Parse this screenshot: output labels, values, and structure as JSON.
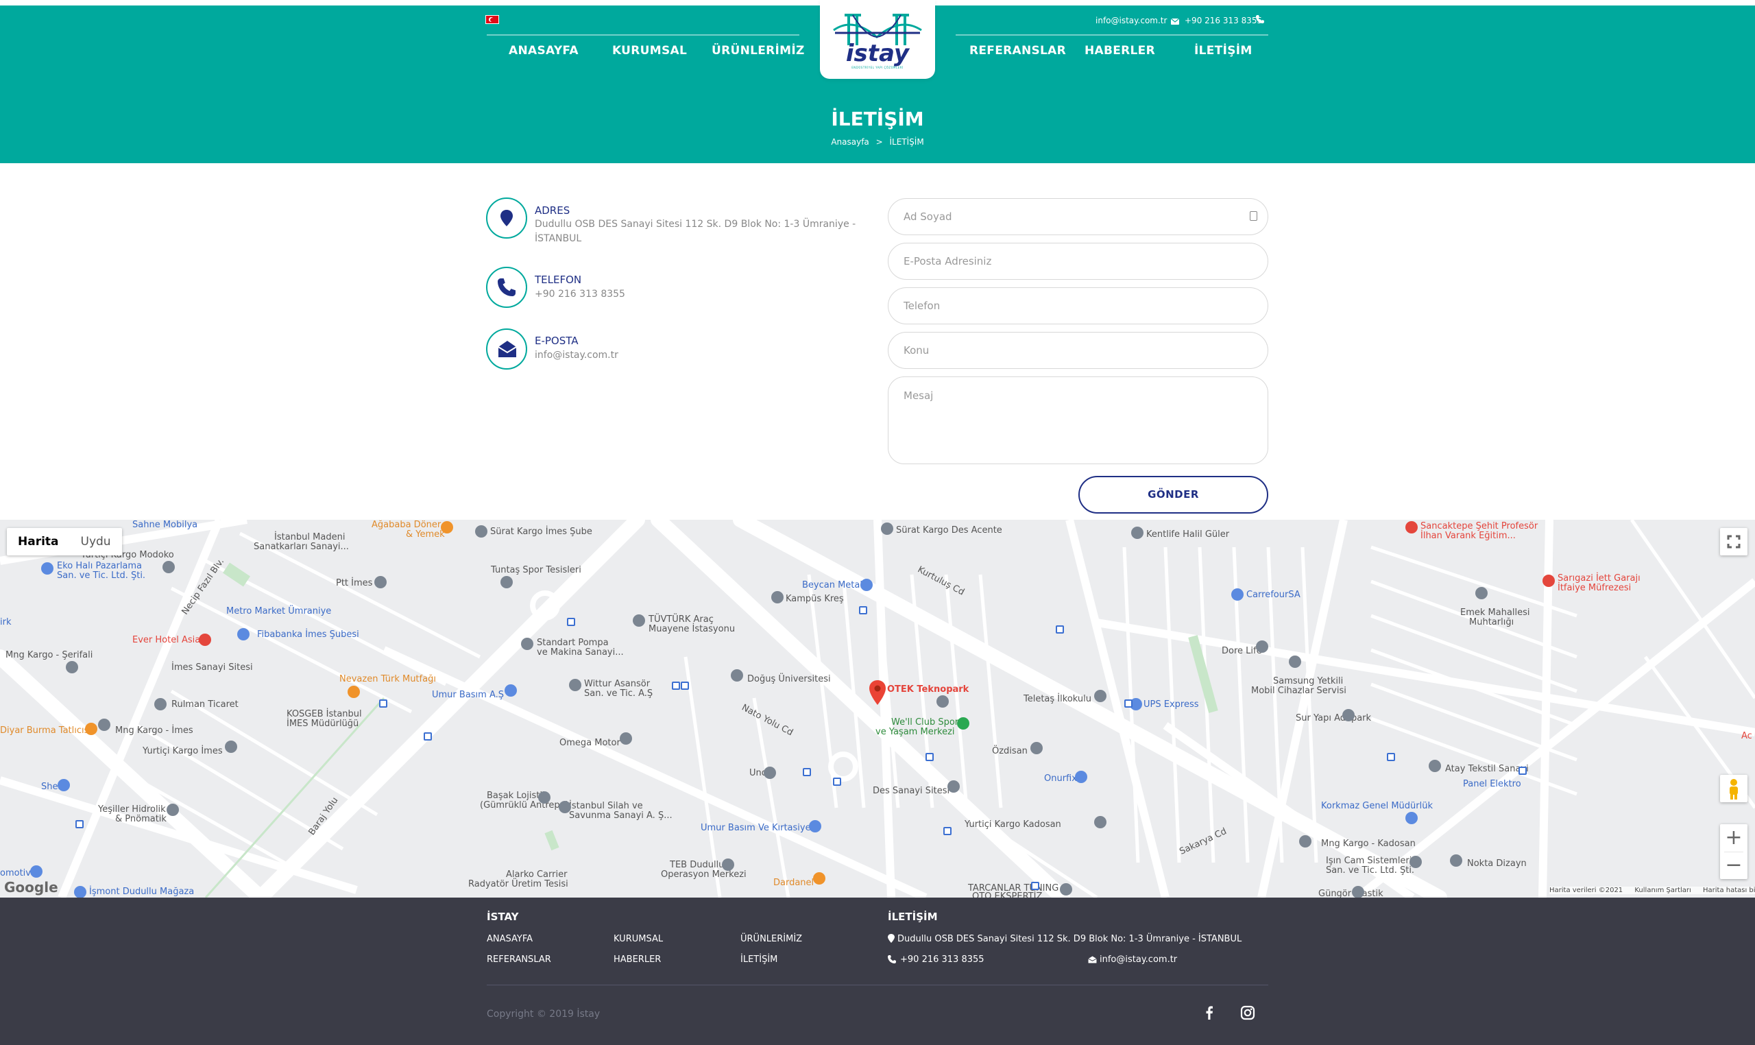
{
  "header": {
    "email": "info@istay.com.tr",
    "phone": "+90 216 313 8355",
    "nav_left": [
      "ANASAYFA",
      "KURUMSAL",
      "ÜRÜNLERİMİZ"
    ],
    "nav_right": [
      "REFERANSLAR",
      "HABERLER",
      "İLETİŞİM"
    ],
    "logo_text": "istay",
    "logo_tagline": "ENDÜSTRİYEL YAPI ÇÖZÜMLERİ"
  },
  "page": {
    "title": "İLETİŞİM",
    "breadcrumb_home": "Anasayfa",
    "breadcrumb_sep": ">",
    "breadcrumb_current": "İLETİŞİM"
  },
  "contact": {
    "address_label": "ADRES",
    "address_line1": "Dudullu OSB DES Sanayi Sitesi 112 Sk. D9 Blok No: 1-3 Ümraniye -",
    "address_line2": "İSTANBUL",
    "phone_label": "TELEFON",
    "phone_value": "+90 216 313 8355",
    "email_label": "E-POSTA",
    "email_value": "info@istay.com.tr"
  },
  "form": {
    "name_placeholder": "Ad Soyad",
    "email_placeholder": "E-Posta Adresiniz",
    "phone_placeholder": "Telefon",
    "subject_placeholder": "Konu",
    "message_placeholder": "Mesaj",
    "submit_label": "GÖNDER"
  },
  "map": {
    "type_map": "Harita",
    "type_satellite": "Uydu",
    "zoom_in": "+",
    "zoom_out": "−",
    "google": "Google",
    "attribution": [
      "Harita verileri ©2021",
      "Kullanım Şartları",
      "Harita hatası bildirin"
    ],
    "marker_label": "OTEK Teknopark",
    "labels": [
      {
        "t": "Sahne Mobilya",
        "c": "mb"
      },
      {
        "t": "İstanbul Madeni",
        "c": "mg"
      },
      {
        "t": "Sanatkarları Sanayi...",
        "c": "mg"
      },
      {
        "t": "Ağababa Döner",
        "c": "mo"
      },
      {
        "t": "& Yemek",
        "c": "mo"
      },
      {
        "t": "Sürat Kargo İmes Şube",
        "c": "mg"
      },
      {
        "t": "Sürat Kargo Des Acente",
        "c": "mg"
      },
      {
        "t": "Kentlife Halil Güler",
        "c": "mg"
      },
      {
        "t": "Sancaktepe Şehit Profesör",
        "c": "mr"
      },
      {
        "t": "İlhan Varank Eğitim...",
        "c": "mr"
      },
      {
        "t": "Yurtiçi Kargo Modoko",
        "c": "mg"
      },
      {
        "t": "Eko Halı Pazarlama",
        "c": "mb"
      },
      {
        "t": "San. ve Tic. Ltd. Şti.",
        "c": "mb"
      },
      {
        "t": "Ptt İmes",
        "c": "mg"
      },
      {
        "t": "Tuntaş Spor Tesisleri",
        "c": "mg"
      },
      {
        "t": "Beycan Metal",
        "c": "mb"
      },
      {
        "t": "Kampüs Kreş",
        "c": "mg"
      },
      {
        "t": "CarrefourSA",
        "c": "mb"
      },
      {
        "t": "Sarıgazi İett Garajı",
        "c": "mr"
      },
      {
        "t": "İtfaiye Müfrezesi",
        "c": "mr"
      },
      {
        "t": "Emek Mahallesi",
        "c": "mg"
      },
      {
        "t": "Muhtarlığı",
        "c": "mg"
      },
      {
        "t": "Metro Market Ümraniye",
        "c": "mb"
      },
      {
        "t": "Fibabanka İmes Şubesi",
        "c": "mb"
      },
      {
        "t": "TÜVTÜRK Araç",
        "c": "mg"
      },
      {
        "t": "Muayene İstasyonu",
        "c": "mg"
      },
      {
        "t": "Ever Hotel Asia",
        "c": "mr"
      },
      {
        "t": "Standart Pompa",
        "c": "mg"
      },
      {
        "t": "ve Makina Sanayi...",
        "c": "mg"
      },
      {
        "t": "Dore Life",
        "c": "mg"
      },
      {
        "t": "Mng Kargo - Şerifali",
        "c": "mg"
      },
      {
        "t": "İmes Sanayi Sitesi",
        "c": "mg"
      },
      {
        "t": "Nevazen Türk Mutfağı",
        "c": "mo"
      },
      {
        "t": "Doğuş Üniversitesi",
        "c": "mg"
      },
      {
        "t": "Samsung Yetkili",
        "c": "mg"
      },
      {
        "t": "Mobil Cihazlar Servisi",
        "c": "mg"
      },
      {
        "t": "Wittur Asansör",
        "c": "mg"
      },
      {
        "t": "San. ve Tic. A.Ş",
        "c": "mg"
      },
      {
        "t": "Umur Basım A.Ş",
        "c": "mb"
      },
      {
        "t": "Teletaş İlkokulu",
        "c": "mg"
      },
      {
        "t": "UPS Express",
        "c": "mb"
      },
      {
        "t": "Rulman Ticaret",
        "c": "mg"
      },
      {
        "t": "KOSGEB İstanbul",
        "c": "mg"
      },
      {
        "t": "İMES Müdürlüğü",
        "c": "mg"
      },
      {
        "t": "Sur Yapı Adapark",
        "c": "mg"
      },
      {
        "t": "Diyar Burma Tatlıcısı",
        "c": "mo"
      },
      {
        "t": "Mng Kargo - İmes",
        "c": "mg"
      },
      {
        "t": "We'll Club Spor",
        "c": "mgr"
      },
      {
        "t": "ve Yaşam Merkezi",
        "c": "mgr"
      },
      {
        "t": "Omega Motor",
        "c": "mg"
      },
      {
        "t": "Özdisan",
        "c": "mg"
      },
      {
        "t": "Yurtiçi Kargo İmes",
        "c": "mg"
      },
      {
        "t": "Atay Tekstil Sanayi",
        "c": "mg"
      },
      {
        "t": "Panel Elektro",
        "c": "mb"
      },
      {
        "t": "Uno",
        "c": "mg"
      },
      {
        "t": "Onurfix",
        "c": "mb"
      },
      {
        "t": "Shell",
        "c": "mb"
      },
      {
        "t": "Başak Lojistik",
        "c": "mg"
      },
      {
        "t": "(Gümrüklü Antrepo)",
        "c": "mg"
      },
      {
        "t": "İstanbul Silah ve",
        "c": "mg"
      },
      {
        "t": "Savunma Sanayi A. Ş...",
        "c": "mg"
      },
      {
        "t": "Des Sanayi Sitesi",
        "c": "mg"
      },
      {
        "t": "Yeşiller Hidrolik",
        "c": "mg"
      },
      {
        "t": "& Pnömatik",
        "c": "mg"
      },
      {
        "t": "Korkmaz Genel Müdürlük",
        "c": "mb"
      },
      {
        "t": "Umur Basım Ve Kırtasiye",
        "c": "mb"
      },
      {
        "t": "Yurtiçi Kargo Kadosan",
        "c": "mg"
      },
      {
        "t": "Mng Kargo - Kadosan",
        "c": "mg"
      },
      {
        "t": "Işın Cam Sistemleri",
        "c": "mg"
      },
      {
        "t": "San. ve Tic. Ltd. Şti.",
        "c": "mg"
      },
      {
        "t": "Nokta Dizayn",
        "c": "mg"
      },
      {
        "t": "TEB Dudullu",
        "c": "mg"
      },
      {
        "t": "Operasyon Merkezi",
        "c": "mg"
      },
      {
        "t": "Alarko Carrier",
        "c": "mg"
      },
      {
        "t": "Radyatör Üretim Tesisi",
        "c": "mg"
      },
      {
        "t": "Dardanel",
        "c": "mo"
      },
      {
        "t": "TARCANLAR TUNING",
        "c": "mg"
      },
      {
        "t": "OTO EKSPERTİZ",
        "c": "mg"
      },
      {
        "t": "Güngör Plastik",
        "c": "mg"
      },
      {
        "t": "İşmont Dudullu Mağaza",
        "c": "mb"
      },
      {
        "t": "omotiv",
        "c": "mb"
      },
      {
        "t": "Nato Yolu Cd",
        "c": "mg"
      },
      {
        "t": "Necip Fazıl Blv.",
        "c": "mg"
      },
      {
        "t": "Baraj Yolu",
        "c": "mg"
      },
      {
        "t": "Kurtuluş Cd",
        "c": "mg"
      },
      {
        "t": "Sakarya Cd",
        "c": "mg"
      },
      {
        "t": "Ac",
        "c": "mr"
      },
      {
        "t": "irk",
        "c": "mb"
      }
    ]
  },
  "footer": {
    "brand_title": "İSTAY",
    "links": [
      "ANASAYFA",
      "KURUMSAL",
      "ÜRÜNLERİMİZ",
      "REFERANSLAR",
      "HABERLER",
      "İLETİŞİM"
    ],
    "contact_title": "İLETİŞİM",
    "address": "Dudullu OSB DES Sanayi Sitesi 112 Sk. D9 Blok No: 1-3 Ümraniye - İSTANBUL",
    "phone": "+90 216 313 8355",
    "email": "info@istay.com.tr",
    "copyright": "Copyright © 2019 İstay"
  },
  "colors": {
    "primary": "#00a99d",
    "navy": "#1f2f85",
    "footer": "#3b3c47"
  }
}
